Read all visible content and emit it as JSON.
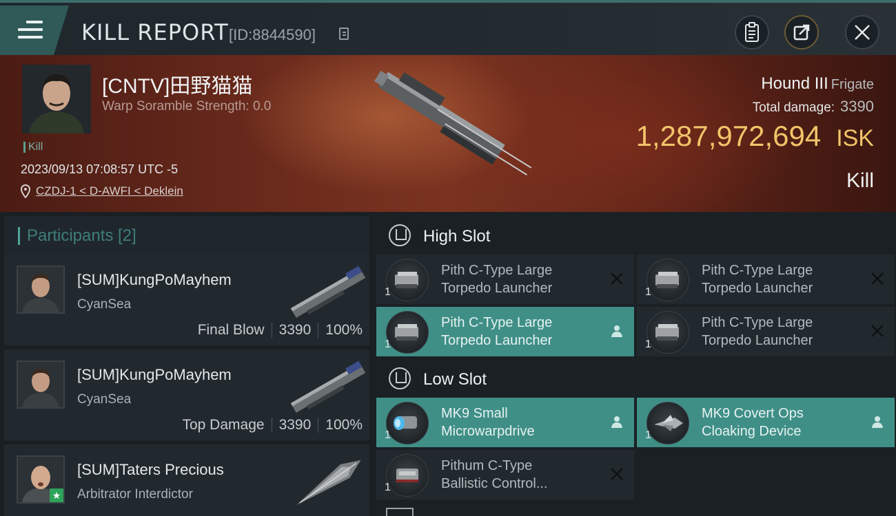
{
  "header": {
    "title": "KILL REPORT",
    "report_id": "[ID:8844590]"
  },
  "victim": {
    "name": "[CNTV]田野猫猫",
    "warp_scramble": "Warp Soramble Strength: 0.0",
    "tag": "Kill",
    "time": "2023/09/13 07:08:57 UTC -5",
    "location": "CZDJ-1 < D-AWFI < Deklein",
    "ship_name": "Hound III",
    "ship_class": "Frigate",
    "total_damage_label": "Total damage:",
    "total_damage": "3390",
    "isk_value": "1,287,972,694",
    "isk_unit": "ISK",
    "result": "Kill"
  },
  "participants": {
    "header": "Participants [2]",
    "rows": [
      {
        "name": "[SUM]KungPoMayhem",
        "corp": "CyanSea",
        "role": "Final Blow",
        "damage": "3390",
        "percent": "100%"
      },
      {
        "name": "[SUM]KungPoMayhem",
        "corp": "CyanSea",
        "role": "Top Damage",
        "damage": "3390",
        "percent": "100%"
      },
      {
        "name": "[SUM]Taters Precious",
        "corp": "Arbitrator Interdictor"
      }
    ]
  },
  "fittings": {
    "high_slot_title": "High Slot",
    "low_slot_title": "Low Slot",
    "high": [
      {
        "line1": "Pith C-Type Large",
        "line2": "Torpedo Launcher",
        "qty": "1",
        "state": "destroyed"
      },
      {
        "line1": "Pith C-Type Large",
        "line2": "Torpedo Launcher",
        "qty": "1",
        "state": "destroyed"
      },
      {
        "line1": "Pith C-Type Large",
        "line2": "Torpedo Launcher",
        "qty": "1",
        "state": "dropped"
      },
      {
        "line1": "Pith C-Type Large",
        "line2": "Torpedo Launcher",
        "qty": "1",
        "state": "destroyed"
      }
    ],
    "low": [
      {
        "line1": "MK9 Small",
        "line2": "Microwarpdrive",
        "qty": "1",
        "state": "dropped"
      },
      {
        "line1": "MK9 Covert Ops",
        "line2": "Cloaking Device",
        "qty": "1",
        "state": "dropped"
      },
      {
        "line1": "Pithum C-Type",
        "line2": "Ballistic Control...",
        "qty": "1",
        "state": "destroyed"
      }
    ]
  },
  "colors": {
    "accent": "#3f8f87",
    "isk": "#f2c46a",
    "header_teal": "#3f7e7a"
  }
}
